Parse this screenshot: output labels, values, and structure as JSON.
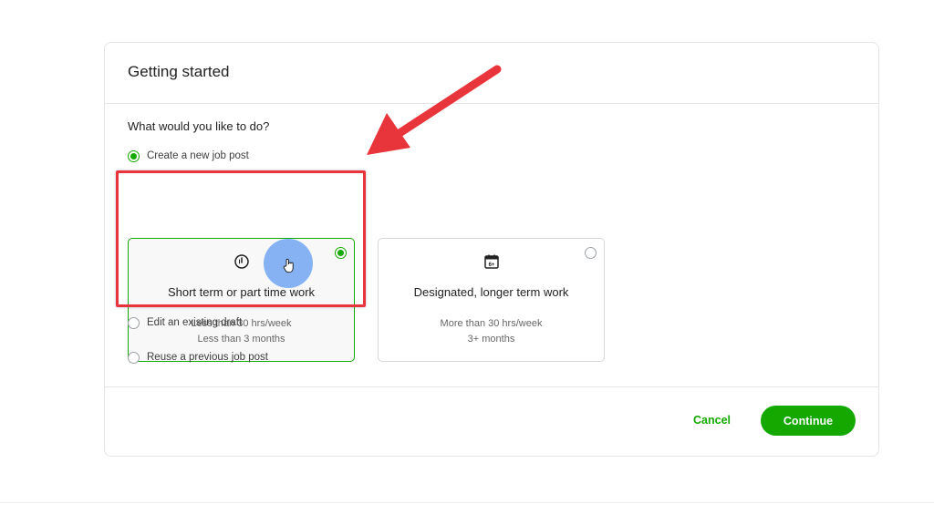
{
  "modal": {
    "title": "Getting started",
    "question": "What would you like to do?"
  },
  "options": {
    "create_new": "Create a new job post",
    "edit_draft": "Edit an existing draft",
    "reuse_previous": "Reuse a previous job post"
  },
  "cards": [
    {
      "title": "Short term or part time work",
      "line1": "Less than 30 hrs/week",
      "line2": "Less than 3 months",
      "icon": "clock-icon",
      "selected": true
    },
    {
      "title": "Designated, longer term work",
      "line1": "More than 30 hrs/week",
      "line2": "3+ months",
      "icon": "calendar-icon",
      "calendar_badge": "6+",
      "selected": false
    }
  ],
  "footer": {
    "cancel_label": "Cancel",
    "continue_label": "Continue"
  },
  "colors": {
    "accent": "#14a800",
    "annotation": "#e8343b",
    "cursor_highlight": "#5091f0"
  }
}
